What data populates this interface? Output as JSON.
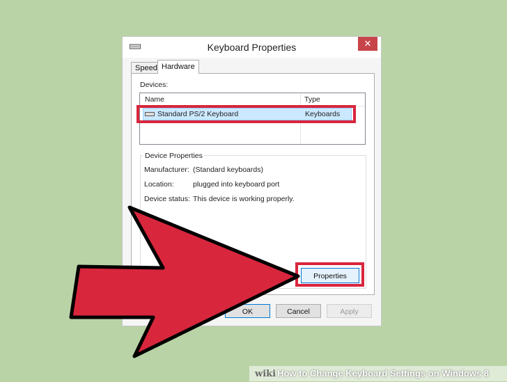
{
  "window": {
    "title": "Keyboard Properties",
    "close_label": "✕"
  },
  "tabs": [
    {
      "label": "Speed",
      "selected": false
    },
    {
      "label": "Hardware",
      "selected": true
    }
  ],
  "devices": {
    "label": "Devices:",
    "columns": [
      "Name",
      "Type"
    ],
    "rows": [
      {
        "name": "Standard PS/2 Keyboard",
        "type": "Keyboards",
        "selected": true
      }
    ]
  },
  "device_properties": {
    "label": "Device Properties",
    "manufacturer_label": "Manufacturer:",
    "manufacturer_value": "(Standard keyboards)",
    "location_label": "Location:",
    "location_value": "plugged into keyboard port",
    "status_label": "Device status:",
    "status_value": "This device is working properly.",
    "properties_button": "Properties"
  },
  "footer_buttons": {
    "ok": "OK",
    "cancel": "Cancel",
    "apply": "Apply"
  },
  "banner": {
    "wiki": "wiki",
    "how_to": "How to Change Keyboard Settings on Windows 8"
  },
  "colors": {
    "background": "#b9d3a6",
    "highlight": "#d8263d",
    "arrow_fill": "#d8263d"
  }
}
